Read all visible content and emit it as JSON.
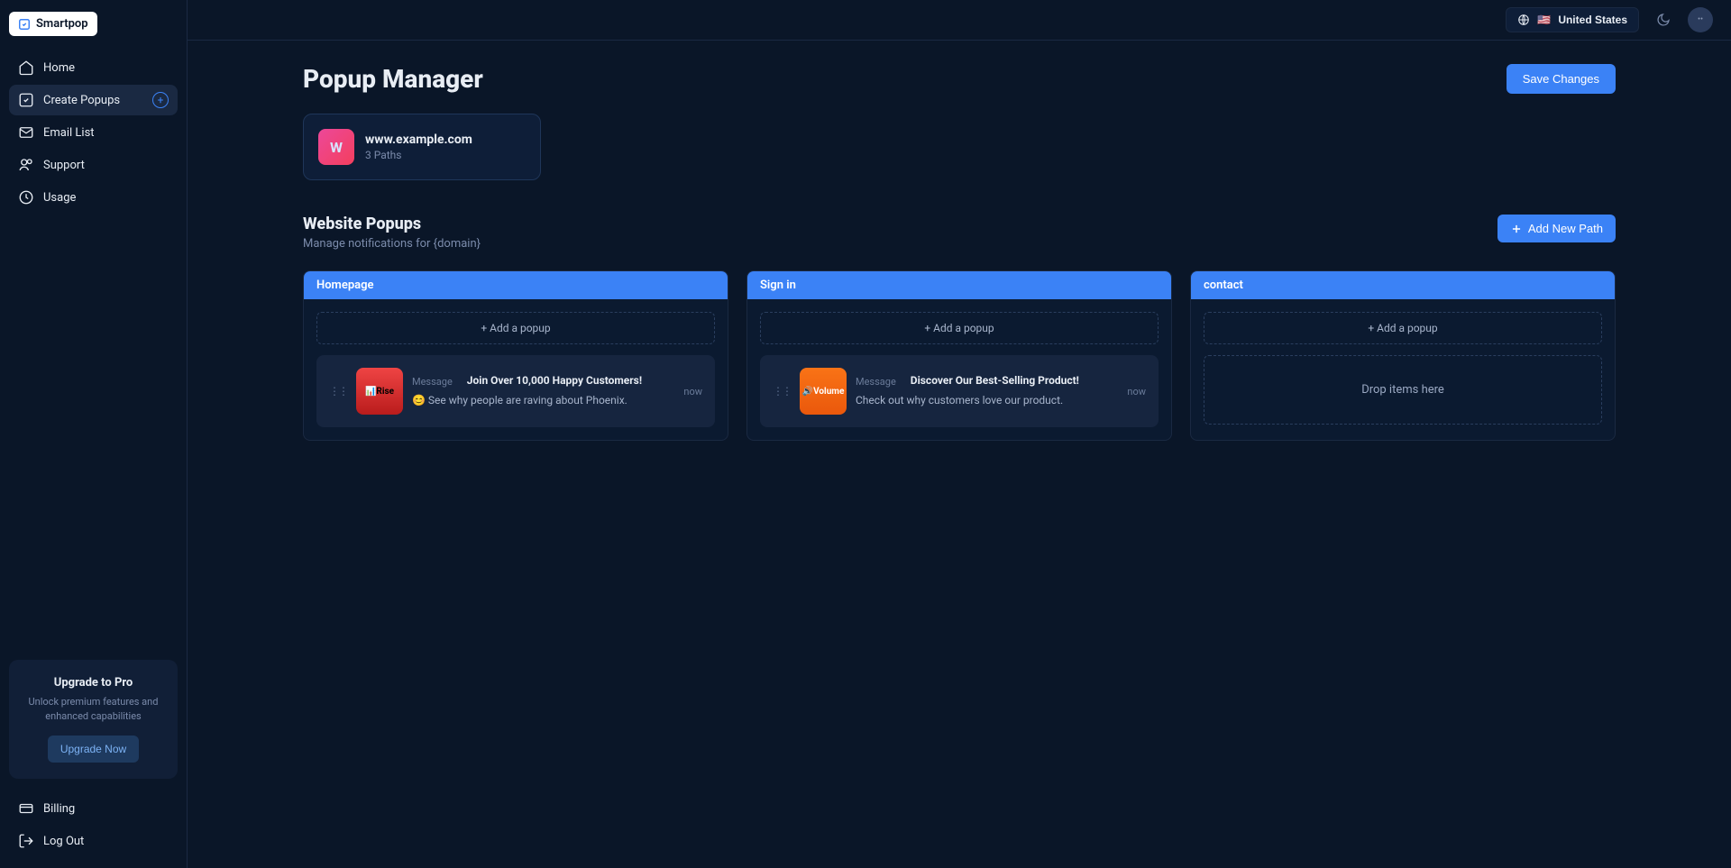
{
  "brand": "Smartpop",
  "nav": {
    "home": "Home",
    "create": "Create Popups",
    "email": "Email List",
    "support": "Support",
    "usage": "Usage",
    "billing": "Billing",
    "logout": "Log Out"
  },
  "upgrade": {
    "title": "Upgrade to Pro",
    "desc": "Unlock premium features and enhanced capabilities",
    "button": "Upgrade Now"
  },
  "topbar": {
    "locale": "United States",
    "flag": "🇺🇸"
  },
  "page": {
    "title": "Popup Manager",
    "save": "Save Changes"
  },
  "website": {
    "initial": "W",
    "name": "www.example.com",
    "paths": "3 Paths"
  },
  "section": {
    "title": "Website Popups",
    "subtitle": "Manage notifications for {domain}",
    "add_path": "Add New Path"
  },
  "columns": [
    {
      "title": "Homepage"
    },
    {
      "title": "Sign in"
    },
    {
      "title": "contact"
    }
  ],
  "add_popup_label": "+ Add a popup",
  "drop_label": "Drop items here",
  "cards": {
    "homepage": {
      "label": "Message",
      "title": "Join Over 10,000 Happy Customers!",
      "desc": "😊 See why people are raving about Phoenix.",
      "brand": "Rise",
      "time": "now"
    },
    "signin": {
      "label": "Message",
      "title": "Discover Our Best-Selling Product!",
      "desc": "Check out why customers love our product.",
      "brand": "Volume",
      "time": "now"
    }
  }
}
